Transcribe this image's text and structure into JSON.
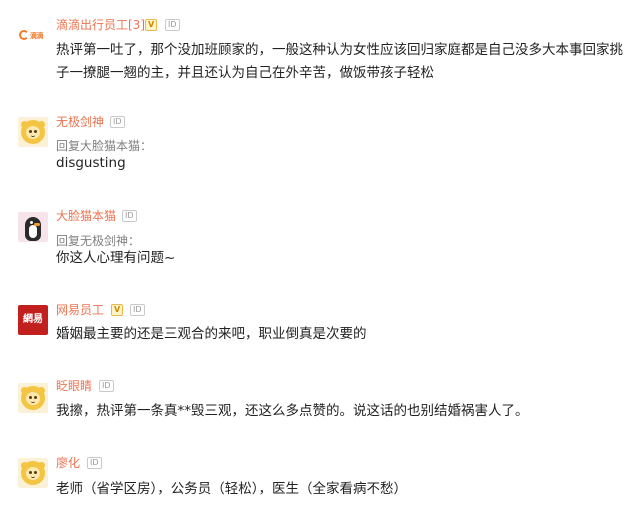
{
  "comments": [
    {
      "username": "滴滴出行员工[3]",
      "badges": [
        "V",
        "ID"
      ],
      "avatar_icon": "didi-logo-avatar",
      "brand_text": "滴滴",
      "lines": [
        "热评第一吐了，那个没加班顾家的，一般这种认为女性应该回归家庭都是自己没多大本事回家挑",
        "子一撩腿一翘的主，并且还认为自己在外辛苦，做饭带孩子轻松"
      ]
    },
    {
      "username": "无极剑神",
      "badges": [
        "ID"
      ],
      "avatar_icon": "yellow-monkey-avatar",
      "reply_to": "回复大脸猫本猫：",
      "lines": [
        "disgusting"
      ]
    },
    {
      "username": "大脸猫本猫",
      "badges": [
        "ID"
      ],
      "avatar_icon": "penguin-avatar",
      "reply_to": "回复无极剑神：",
      "lines": [
        "你这人心理有问题~"
      ]
    },
    {
      "username": "网易员工",
      "badges": [
        "V",
        "ID"
      ],
      "avatar_icon": "netease-logo-avatar",
      "brand_text": "網易",
      "lines": [
        "婚姻最主要的还是三观合的来吧，职业倒真是次要的"
      ]
    },
    {
      "username": "眨眼睛",
      "badges": [
        "ID"
      ],
      "avatar_icon": "yellow-monkey-avatar",
      "lines": [
        "我擦，热评第一条真**毁三观，还这么多点赞的。说这话的也别结婚祸害人了。"
      ]
    },
    {
      "username": "廖化",
      "badges": [
        "ID"
      ],
      "avatar_icon": "yellow-monkey-avatar",
      "lines": [
        "老师（省学区房），公务员（轻松），医生（全家看病不愁）"
      ]
    }
  ],
  "colors": {
    "verified_name": "#eb7350",
    "plain_name": "#999999",
    "text": "#222222"
  }
}
